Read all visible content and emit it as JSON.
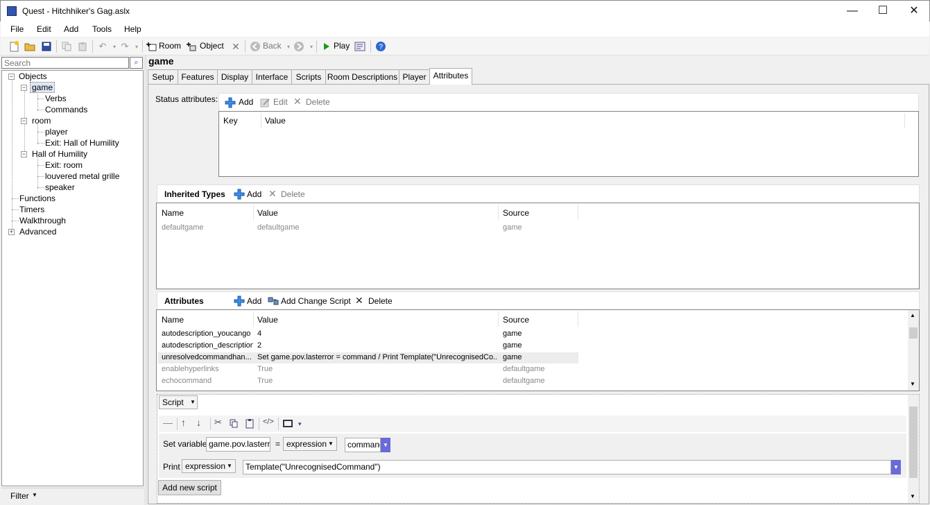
{
  "window": {
    "title": "Quest - Hitchhiker's Gag.aslx",
    "minimize": "—",
    "maximize": "☐",
    "close": "✕"
  },
  "menu": [
    "File",
    "Edit",
    "Add",
    "Tools",
    "Help"
  ],
  "toolbar": {
    "room_label": "Room",
    "object_label": "Object",
    "back_label": "Back",
    "play_label": "Play"
  },
  "left": {
    "search_placeholder": "Search",
    "filter_label": "Filter",
    "tree": {
      "objects": "Objects",
      "game": "game",
      "verbs": "Verbs",
      "commands": "Commands",
      "room": "room",
      "player": "player",
      "exit_hall": "Exit: Hall of Humility",
      "hall": "Hall of Humility",
      "exit_room": "Exit: room",
      "grille": "louvered metal grille",
      "speaker": "speaker",
      "functions": "Functions",
      "timers": "Timers",
      "walkthrough": "Walkthrough",
      "advanced": "Advanced"
    }
  },
  "object_title": "game",
  "tabs": [
    "Setup",
    "Features",
    "Display",
    "Interface",
    "Scripts",
    "Room Descriptions",
    "Player",
    "Attributes"
  ],
  "status": {
    "label": "Status attributes:",
    "add": "Add",
    "edit": "Edit",
    "delete": "Delete",
    "col_key": "Key",
    "col_value": "Value"
  },
  "inherited": {
    "title": "Inherited Types",
    "add": "Add",
    "delete": "Delete",
    "col_name": "Name",
    "col_value": "Value",
    "col_source": "Source",
    "rows": [
      {
        "name": "defaultgame",
        "value": "defaultgame",
        "source": "game"
      }
    ]
  },
  "attributes": {
    "title": "Attributes",
    "add": "Add",
    "add_change_script": "Add Change Script",
    "delete": "Delete",
    "col_name": "Name",
    "col_value": "Value",
    "col_source": "Source",
    "rows": [
      {
        "name": "autodescription_youcango",
        "value": "4",
        "source": "game"
      },
      {
        "name": "autodescription_description",
        "value": "2",
        "source": "game"
      },
      {
        "name": "unresolvedcommandhan...",
        "value": "Set game.pov.lasterror = command / Print Template(\"UnrecognisedCo...",
        "source": "game"
      },
      {
        "name": "enablehyperlinks",
        "value": "True",
        "source": "defaultgame"
      },
      {
        "name": "echocommand",
        "value": "True",
        "source": "defaultgame"
      }
    ]
  },
  "script_editor": {
    "type_label": "Script",
    "set_variable_label": "Set variable",
    "variable_value": "game.pov.lasterror",
    "equals": "=",
    "expression_combo": "expression",
    "command_value": "command",
    "print_label": "Print",
    "print_combo": "expression",
    "print_value": "Template(\"UnrecognisedCommand\")",
    "add_new_script": "Add new script"
  }
}
